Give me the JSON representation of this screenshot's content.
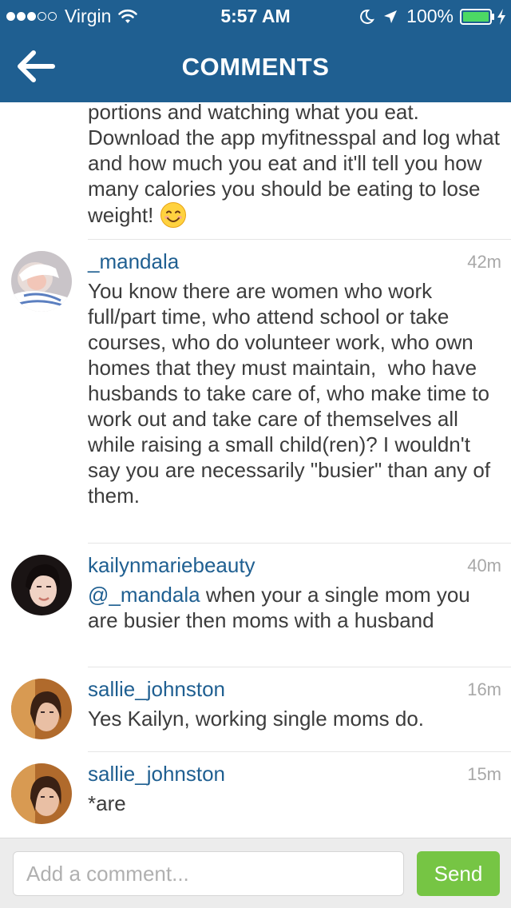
{
  "status_bar": {
    "carrier": "Virgin",
    "signal_full_dots": 3,
    "signal_empty_dots": 2,
    "time": "5:57 AM",
    "battery": "100%"
  },
  "nav": {
    "title": "COMMENTS",
    "back_icon": "arrow-left-icon"
  },
  "comments": [
    {
      "partial": true,
      "text": "portions and watching what you eat. Download the app myfitnesspal and log what and how much you eat and it'll tell you how many calories you should be eating to lose weight!",
      "emoji": "smiling-face-emoji"
    },
    {
      "username": "_mandala",
      "time": "42m",
      "text": "You know there are women who work full/part time, who attend school or take courses, who do volunteer work, who own homes that they must maintain,  who have husbands to take care of, who make time to work out and take care of themselves all while raising a small child(ren)? I wouldn't say you are necessarily \"busier\" than any of them."
    },
    {
      "username": "kailynmariebeauty",
      "time": "40m",
      "mention": "@_mandala",
      "text": " when your a single mom you are busier then moms with a husband"
    },
    {
      "username": "sallie_johnston",
      "time": "16m",
      "text": "Yes Kailyn, working single moms do."
    },
    {
      "username": "sallie_johnston",
      "time": "15m",
      "text": "*are"
    }
  ],
  "composer": {
    "placeholder": "Add a comment...",
    "value": "",
    "send_label": "Send"
  },
  "colors": {
    "header": "#1f5f91",
    "username": "#1f5f91",
    "send_button": "#70c33c",
    "timestamp": "#a8a8a8"
  }
}
